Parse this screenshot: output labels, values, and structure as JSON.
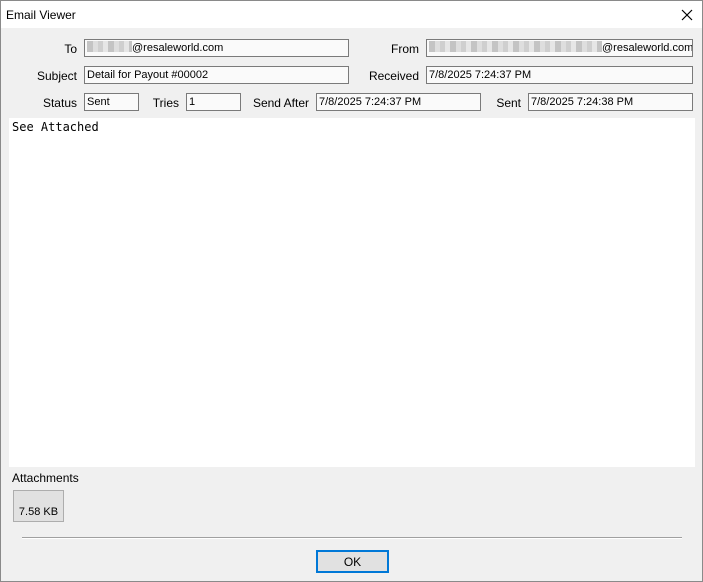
{
  "window": {
    "title": "Email Viewer"
  },
  "fields": {
    "to": {
      "label": "To",
      "value": "@resaleworld.com"
    },
    "from": {
      "label": "From",
      "value": "@resaleworld.com"
    },
    "subject": {
      "label": "Subject",
      "value": "Detail for Payout #00002"
    },
    "received": {
      "label": "Received",
      "value": "7/8/2025 7:24:37 PM"
    },
    "status": {
      "label": "Status",
      "value": "Sent"
    },
    "tries": {
      "label": "Tries",
      "value": "1"
    },
    "send_after": {
      "label": "Send After",
      "value": "7/8/2025 7:24:37 PM"
    },
    "sent": {
      "label": "Sent",
      "value": "7/8/2025 7:24:38 PM"
    }
  },
  "message": {
    "body": "See Attached"
  },
  "attachments": {
    "label": "Attachments",
    "items": [
      {
        "size": "7.58 KB"
      }
    ]
  },
  "buttons": {
    "ok": "OK"
  },
  "icons": {
    "close": "close-icon",
    "attachment": "file-icon"
  }
}
